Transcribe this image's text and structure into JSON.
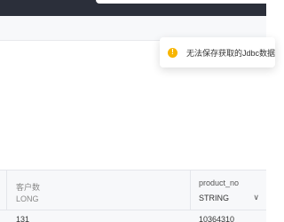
{
  "toast": {
    "icon": "warning-icon",
    "message": "无法保存获取的Jdbc数据"
  },
  "table": {
    "columns": [
      {
        "name": "客户数",
        "type": "LONG"
      },
      {
        "name": "product_no",
        "type": "STRING"
      }
    ],
    "rows": [
      [
        "131",
        "10364310"
      ]
    ]
  }
}
